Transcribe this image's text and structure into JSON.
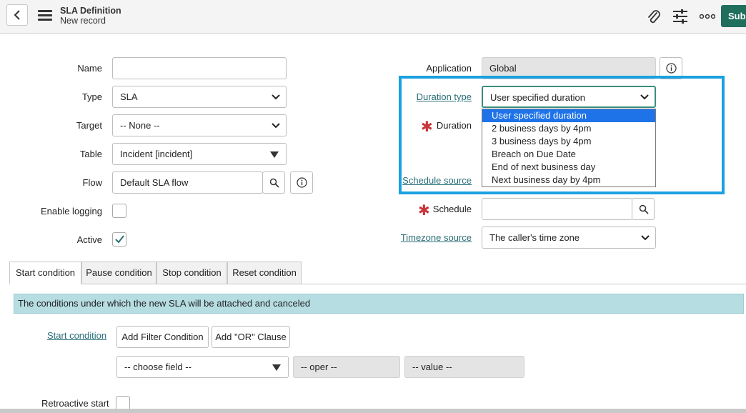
{
  "header": {
    "title": "SLA Definition",
    "subtitle": "New record",
    "submit_label": "Subm",
    "icons": [
      "back-icon",
      "menu-icon",
      "paperclip-icon",
      "sliders-icon",
      "more-icon"
    ]
  },
  "left_form": {
    "name_label": "Name",
    "name_value": "",
    "type_label": "Type",
    "type_value": "SLA",
    "target_label": "Target",
    "target_value": "-- None --",
    "table_label": "Table",
    "table_value": "Incident [incident]",
    "flow_label": "Flow",
    "flow_value": "Default SLA flow",
    "enable_logging_label": "Enable logging",
    "enable_logging_checked": false,
    "active_label": "Active",
    "active_checked": true
  },
  "right_form": {
    "application_label": "Application",
    "application_value": "Global",
    "duration_type_label": "Duration type",
    "duration_type_value": "User specified duration",
    "duration_label": "Duration",
    "schedule_source_label": "Schedule source",
    "schedule_label": "Schedule",
    "schedule_value": "",
    "timezone_source_label": "Timezone source",
    "timezone_source_value": "The caller's time zone"
  },
  "duration_dropdown": {
    "options": [
      "User specified duration",
      "2 business days by 4pm",
      "3 business days by 4pm",
      "Breach on Due Date",
      "End of next business day",
      "Next business day by 4pm"
    ],
    "selected_index": 0
  },
  "tabs": [
    "Start condition",
    "Pause condition",
    "Stop condition",
    "Reset condition"
  ],
  "active_tab": 0,
  "condition_section": {
    "info_text": "The conditions under which the new SLA will be attached and canceled",
    "start_condition_label": "Start condition",
    "add_filter_label": "Add Filter Condition",
    "add_or_label": "Add \"OR\" Clause",
    "field_placeholder": "-- choose field --",
    "oper_placeholder": "-- oper --",
    "value_placeholder": "-- value --",
    "retroactive_start_label": "Retroactive start"
  },
  "colors": {
    "accent": "#1aa1e0",
    "submit_bg": "#1f6f5c",
    "link": "#2a6e78",
    "info_bar": "#b6dde2",
    "required": "#c8343a",
    "selected_option": "#1e73e8"
  }
}
